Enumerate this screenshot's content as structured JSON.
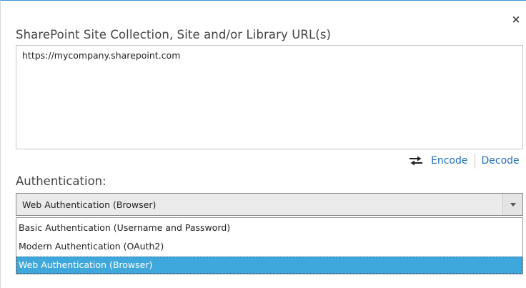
{
  "dialog": {
    "close_glyph": "×",
    "url_label": "SharePoint Site Collection, Site and/or Library URL(s)",
    "url_value": "https://mycompany.sharepoint.com",
    "encode_label": "Encode",
    "decode_label": "Decode",
    "auth_label": "Authentication:",
    "auth_selected": "Web Authentication (Browser)",
    "auth_options": [
      "Basic Authentication (Username and Password)",
      "Modern Authentication (OAuth2)",
      "Web Authentication (Browser)"
    ],
    "selected_index": 2
  },
  "colors": {
    "accent": "#1f6fb8",
    "selection": "#3ea8dc",
    "top_border": "#3d8fd4"
  },
  "icons": {
    "close": "close-icon",
    "swap": "swap-arrows-icon",
    "dropdown": "dropdown-arrow-icon"
  }
}
